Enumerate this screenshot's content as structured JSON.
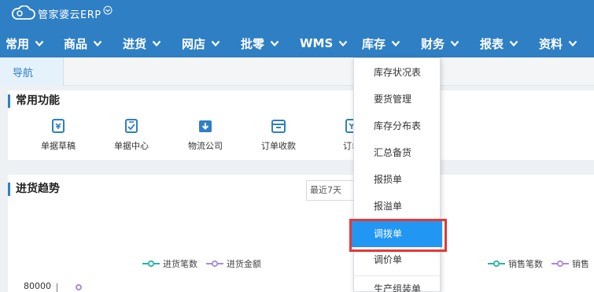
{
  "brand": {
    "name": "管家婆云ERP"
  },
  "nav": {
    "items": [
      {
        "label": "常用"
      },
      {
        "label": "商品"
      },
      {
        "label": "进货"
      },
      {
        "label": "网店"
      },
      {
        "label": "批零"
      },
      {
        "label": "WMS"
      },
      {
        "label": "库存"
      },
      {
        "label": "财务"
      },
      {
        "label": "报表"
      },
      {
        "label": "资料"
      }
    ]
  },
  "tabs": {
    "nav_label": "导航"
  },
  "common": {
    "title": "常用功能",
    "items": [
      {
        "label": "单据草稿",
        "icon": "draft-icon"
      },
      {
        "label": "单据中心",
        "icon": "document-center-icon"
      },
      {
        "label": "物流公司",
        "icon": "logistics-icon"
      },
      {
        "label": "订单收款",
        "icon": "order-payment-icon"
      },
      {
        "label": "订单",
        "icon": "order-icon"
      }
    ]
  },
  "trend": {
    "title": "进货趋势",
    "range_value": "最近7天",
    "legend_purchase": [
      "进货笔数",
      "进货金额"
    ],
    "legend_sales": [
      "销售笔数",
      "销售"
    ],
    "y_tick_top": "80000",
    "colors": {
      "count": "#26b5a8",
      "amount": "#a98bd9"
    }
  },
  "dropdown": {
    "menu": "库存",
    "items": [
      "库存状况表",
      "要货管理",
      "库存分布表",
      "汇总备货",
      "报损单",
      "报溢单",
      "调拨单",
      "调价单",
      "生产组装单"
    ],
    "selected": "调拨单"
  },
  "colors": {
    "header": "#2f7fc4",
    "selected": "#2196f3",
    "highlight_border": "#e53935"
  }
}
